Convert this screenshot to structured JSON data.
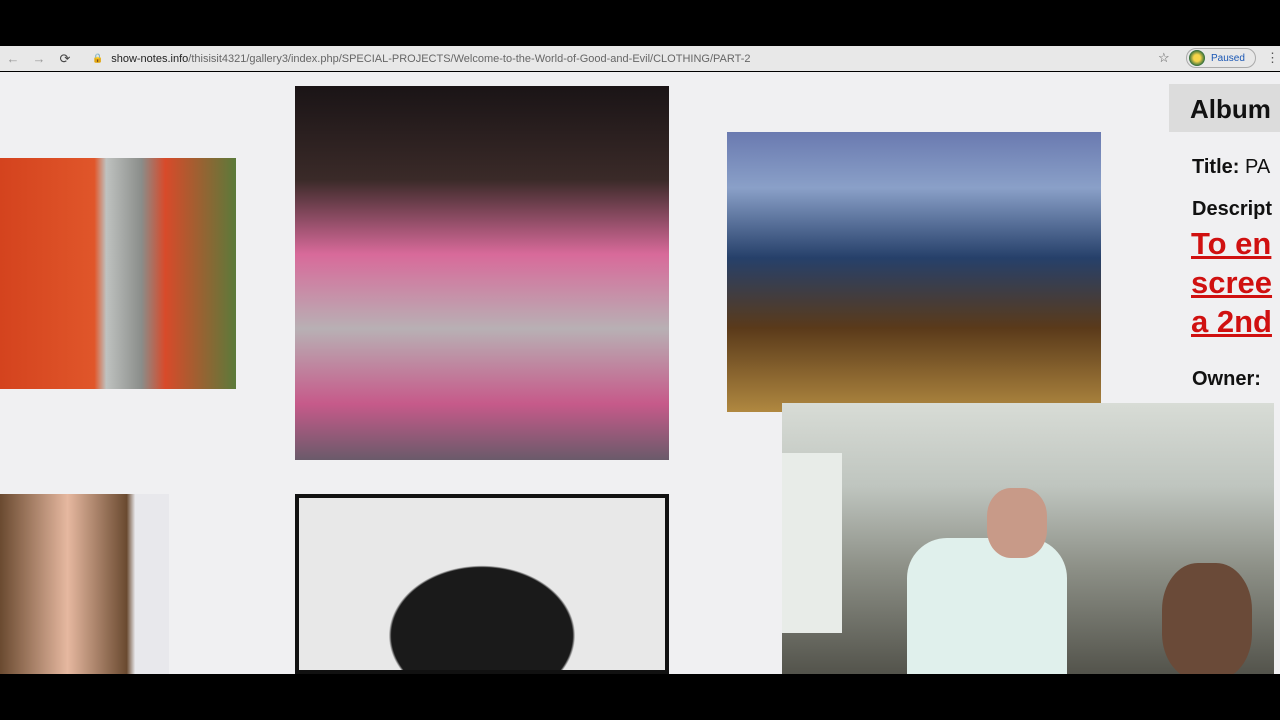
{
  "browser": {
    "back_icon": "←",
    "forward_icon": "→",
    "reload_icon": "⟳",
    "url_domain": "show-notes.info",
    "url_path": "/thisisit4321/gallery3/index.php/SPECIAL-PROJECTS/Welcome-to-the-World-of-Good-and-Evil/CLOTHING/PART-2",
    "star_icon": "☆",
    "profile_status": "Paused",
    "menu_icon": "⋮"
  },
  "sidebar": {
    "header": "Album",
    "title_label": "Title:",
    "title_value": "PA",
    "description_label": "Descript",
    "link_lines": [
      "To en",
      "scree",
      "a 2nd"
    ],
    "owner_label": "Owner:"
  }
}
